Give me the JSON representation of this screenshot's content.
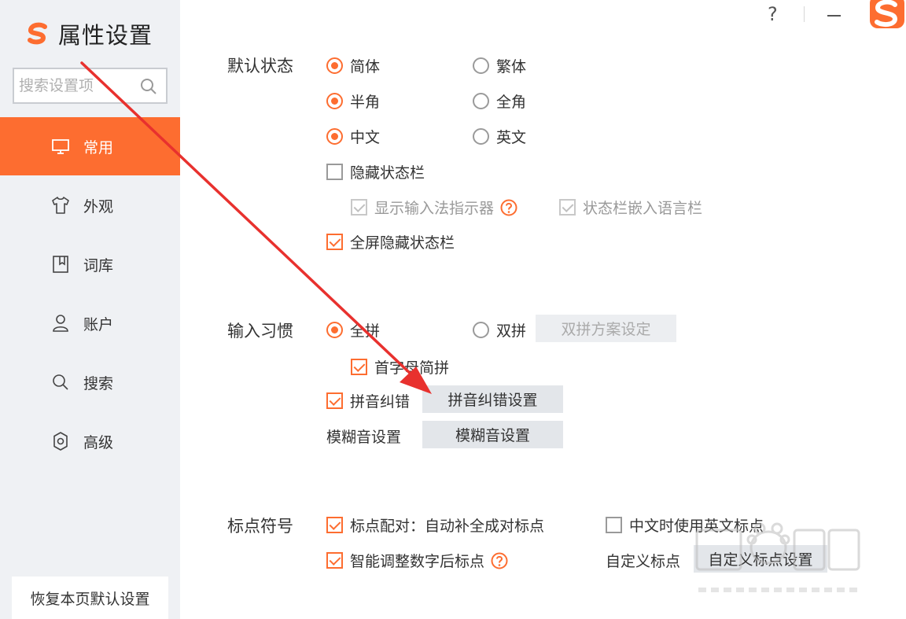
{
  "window": {
    "title": "属性设置",
    "help_label": "?"
  },
  "search": {
    "placeholder": "搜索设置项"
  },
  "sidebar": {
    "items": [
      {
        "label": "常用",
        "icon": "monitor-icon",
        "active": true
      },
      {
        "label": "外观",
        "icon": "shirt-icon",
        "active": false
      },
      {
        "label": "词库",
        "icon": "book-icon",
        "active": false
      },
      {
        "label": "账户",
        "icon": "user-icon",
        "active": false
      },
      {
        "label": "搜索",
        "icon": "search-icon",
        "active": false
      },
      {
        "label": "高级",
        "icon": "gear-icon",
        "active": false
      }
    ],
    "reset_label": "恢复本页默认设置"
  },
  "default_state": {
    "label": "默认状态",
    "simplified": "简体",
    "traditional": "繁体",
    "half_width": "半角",
    "full_width": "全角",
    "chinese": "中文",
    "english": "英文",
    "hide_status_bar": "隐藏状态栏",
    "show_indicator": "显示输入法指示器",
    "embed_language_bar": "状态栏嵌入语言栏",
    "fullscreen_hide": "全屏隐藏状态栏"
  },
  "input_habit": {
    "label": "输入习惯",
    "full_pinyin": "全拼",
    "double_pinyin": "双拼",
    "double_pinyin_button": "双拼方案设定",
    "initial_abbrev": "首字母简拼",
    "pinyin_correction": "拼音纠错",
    "pinyin_correction_button": "拼音纠错设置",
    "fuzzy_label": "模糊音设置",
    "fuzzy_button": "模糊音设置"
  },
  "punctuation": {
    "label": "标点符号",
    "auto_pair": "标点配对：自动补全成对标点",
    "english_punct": "中文时使用英文标点",
    "smart_adjust": "智能调整数字后标点",
    "custom_label": "自定义标点",
    "custom_button": "自定义标点设置"
  },
  "colors": {
    "accent": "#fd6d30",
    "sidebar_bg": "#eff1f4",
    "button_bg": "#e3e6ea",
    "arrow": "#e8312e"
  }
}
